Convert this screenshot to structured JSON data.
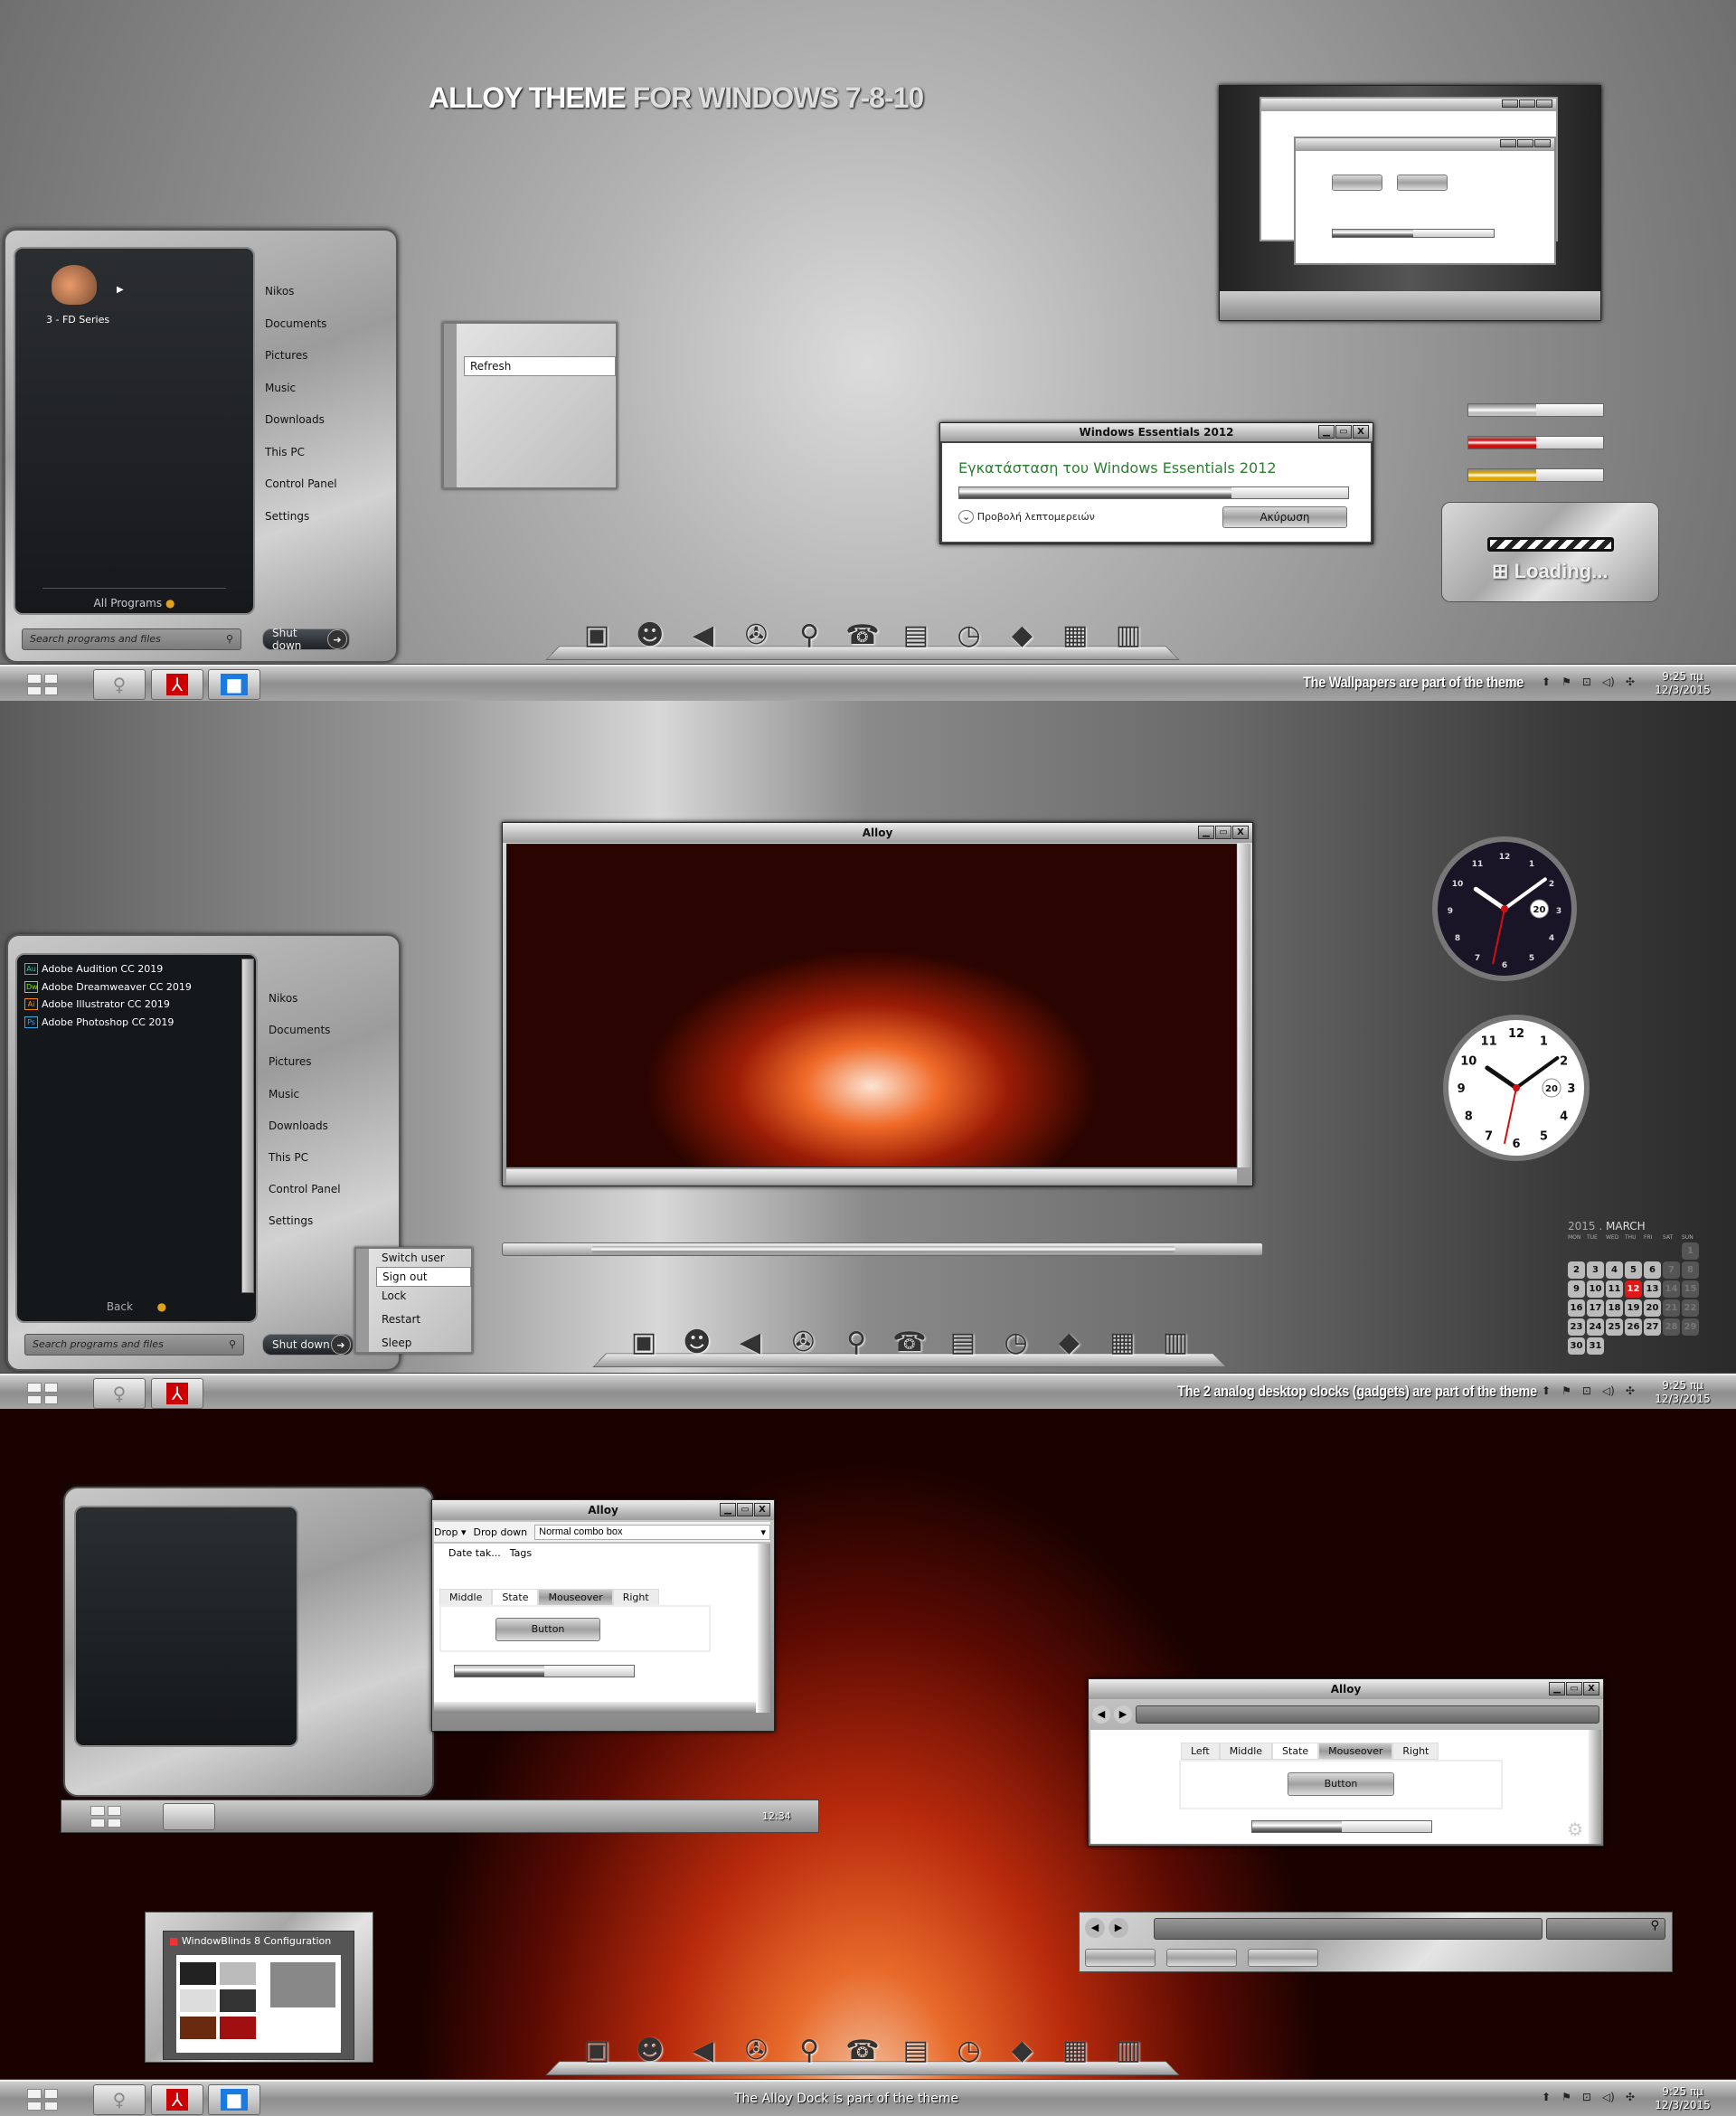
{
  "title": {
    "part1": "ALLOY THEME",
    "part2": "FOR WINDOWS 7-8-10"
  },
  "start_menu_1": {
    "user_tile": "3 - FD Series",
    "places": [
      "Nikos",
      "Documents",
      "Pictures",
      "Music",
      "Downloads",
      "This PC",
      "Control Panel",
      "Settings"
    ],
    "all_programs": "All Programs",
    "search_placeholder": "Search programs and files",
    "shutdown": "Shut down"
  },
  "context_menu": {
    "items": [
      "Refresh"
    ]
  },
  "essentials_dialog": {
    "title": "Windows Essentials 2012",
    "heading": "Εγκατάσταση του Windows Essentials 2012",
    "details": "Προβολή λεπτομερειών",
    "cancel": "Ακύρωση",
    "progress_percent": 70,
    "accent": "#2e7d32"
  },
  "progress_samples": [
    {
      "color": "#c0c0c0",
      "percent": 50
    },
    {
      "color": "#d01010",
      "percent": 50
    },
    {
      "color": "#e0a800",
      "percent": 50
    }
  ],
  "loading": {
    "text": "Loading..."
  },
  "taskbar_1": {
    "note": "The Wallpapers are part of the theme",
    "time": "9:25 πμ",
    "date": "12/3/2015"
  },
  "media_window": {
    "title": "Alloy"
  },
  "start_menu_2": {
    "programs": [
      {
        "badge": "Au",
        "color": "#2fc2a8",
        "name": "Adobe Audition CC 2019"
      },
      {
        "badge": "Dw",
        "color": "#7ee018",
        "name": "Adobe Dreamweaver CC 2019"
      },
      {
        "badge": "Ai",
        "color": "#ff8a00",
        "name": "Adobe Illustrator CC 2019"
      },
      {
        "badge": "Ps",
        "color": "#2fa8e8",
        "name": "Adobe Photoshop CC 2019"
      }
    ],
    "places": [
      "Nikos",
      "Documents",
      "Pictures",
      "Music",
      "Downloads",
      "This PC",
      "Control Panel",
      "Settings"
    ],
    "back": "Back",
    "search_placeholder": "Search programs and files",
    "shutdown": "Shut down",
    "power_menu": [
      "Switch user",
      "Sign out",
      "Lock",
      "Restart",
      "Sleep"
    ],
    "power_menu_highlighted": "Sign out"
  },
  "clock_gadgets": {
    "date": "20",
    "time": "10:09:32"
  },
  "calendar": {
    "year": "2015",
    "month": "MARCH",
    "weekdays": [
      "MON",
      "TUE",
      "WED",
      "THU",
      "FRI",
      "SAT",
      "SUN"
    ],
    "first_weekday_index": 6,
    "days_in_month": 31,
    "today": 12
  },
  "taskbar_2": {
    "note": "The 2 analog desktop clocks (gadgets) are part of the theme",
    "time": "9:25 πμ",
    "date": "12/3/2015"
  },
  "mini_taskbar": {
    "time": "12:34"
  },
  "demo_window_a": {
    "title": "Alloy",
    "drop": "Drop",
    "drop_down": "Drop down",
    "combo_value": "Normal combo box",
    "columns": [
      "Date tak...",
      "Tags"
    ],
    "tabs": [
      "Middle",
      "State",
      "Mouseover",
      "Right"
    ],
    "button": "Button",
    "progress_percent": 50
  },
  "demo_window_b": {
    "title": "Alloy",
    "tabs": [
      "Left",
      "Middle",
      "State",
      "Mouseover",
      "Right"
    ],
    "button": "Button",
    "progress_percent": 50
  },
  "windowblinds": {
    "title": "WindowBlinds 8 Configuration"
  },
  "taskbar_3": {
    "note": "The Alloy Dock is part of the theme",
    "time": "9:25 πμ",
    "date": "12/3/2015"
  },
  "dock_icons": [
    "computer-icon",
    "user-icon",
    "speaker-icon",
    "film-reel-icon",
    "magnifier-icon",
    "phone-icon",
    "font-book-icon",
    "stopwatch-icon",
    "crystal-icon",
    "calculator-icon",
    "trash-icon"
  ]
}
